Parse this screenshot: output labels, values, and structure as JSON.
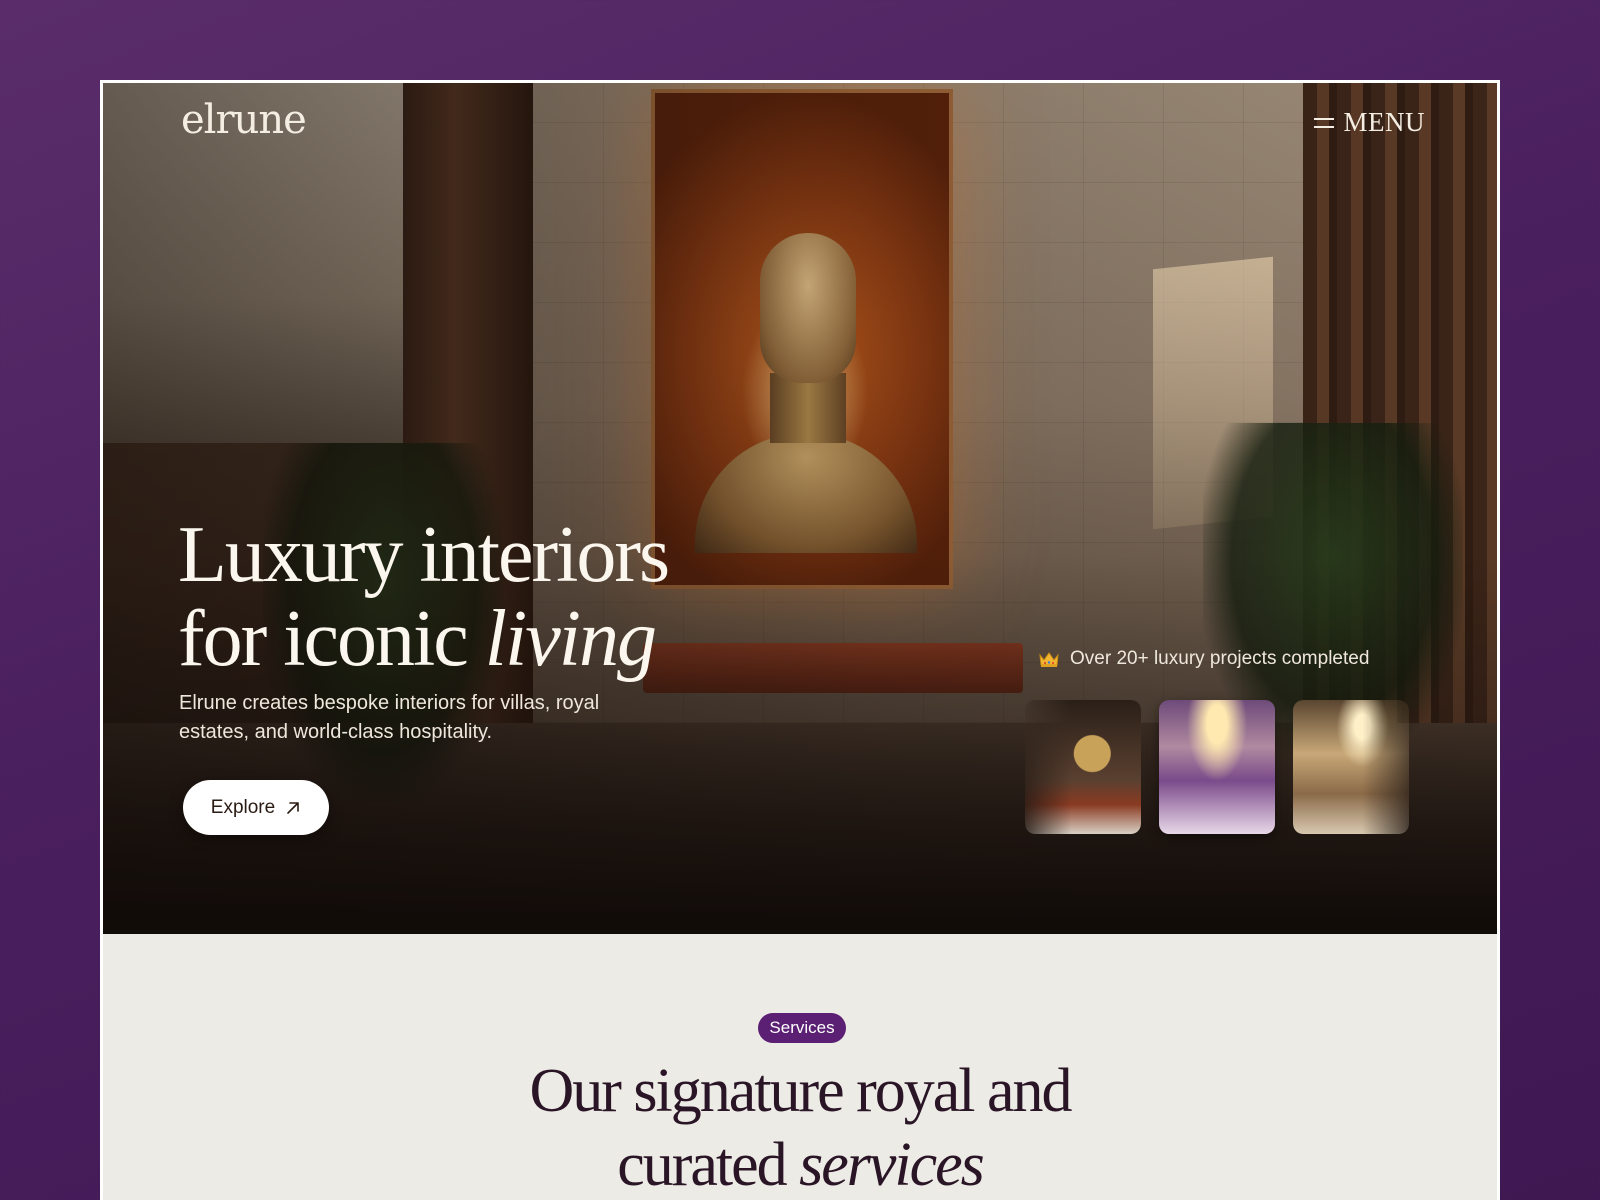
{
  "header": {
    "logo": "elrune",
    "menu_label": "MENU"
  },
  "hero": {
    "title_line1": "Luxury interiors",
    "title_line2_plain": "for iconic ",
    "title_line2_italic": "living",
    "subtitle": "Elrune creates bespoke interiors for villas, royal estates, and world-class hospitality.",
    "cta_label": "Explore"
  },
  "projects": {
    "caption": "Over 20+ luxury projects completed",
    "thumbnails": [
      "lobby-thumbnail",
      "staircase-thumbnail",
      "hall-thumbnail"
    ]
  },
  "services": {
    "badge": "Services",
    "title_line1": "Our signature royal and",
    "title_line2_plain": "curated ",
    "title_line2_italic": "services"
  },
  "colors": {
    "backdrop": "#4a1f5e",
    "badge": "#5b1f73",
    "section_bg": "#edebe6",
    "heading_dark": "#2a1526"
  },
  "icons": [
    "menu-icon",
    "arrow-up-right-icon",
    "crown-icon"
  ]
}
